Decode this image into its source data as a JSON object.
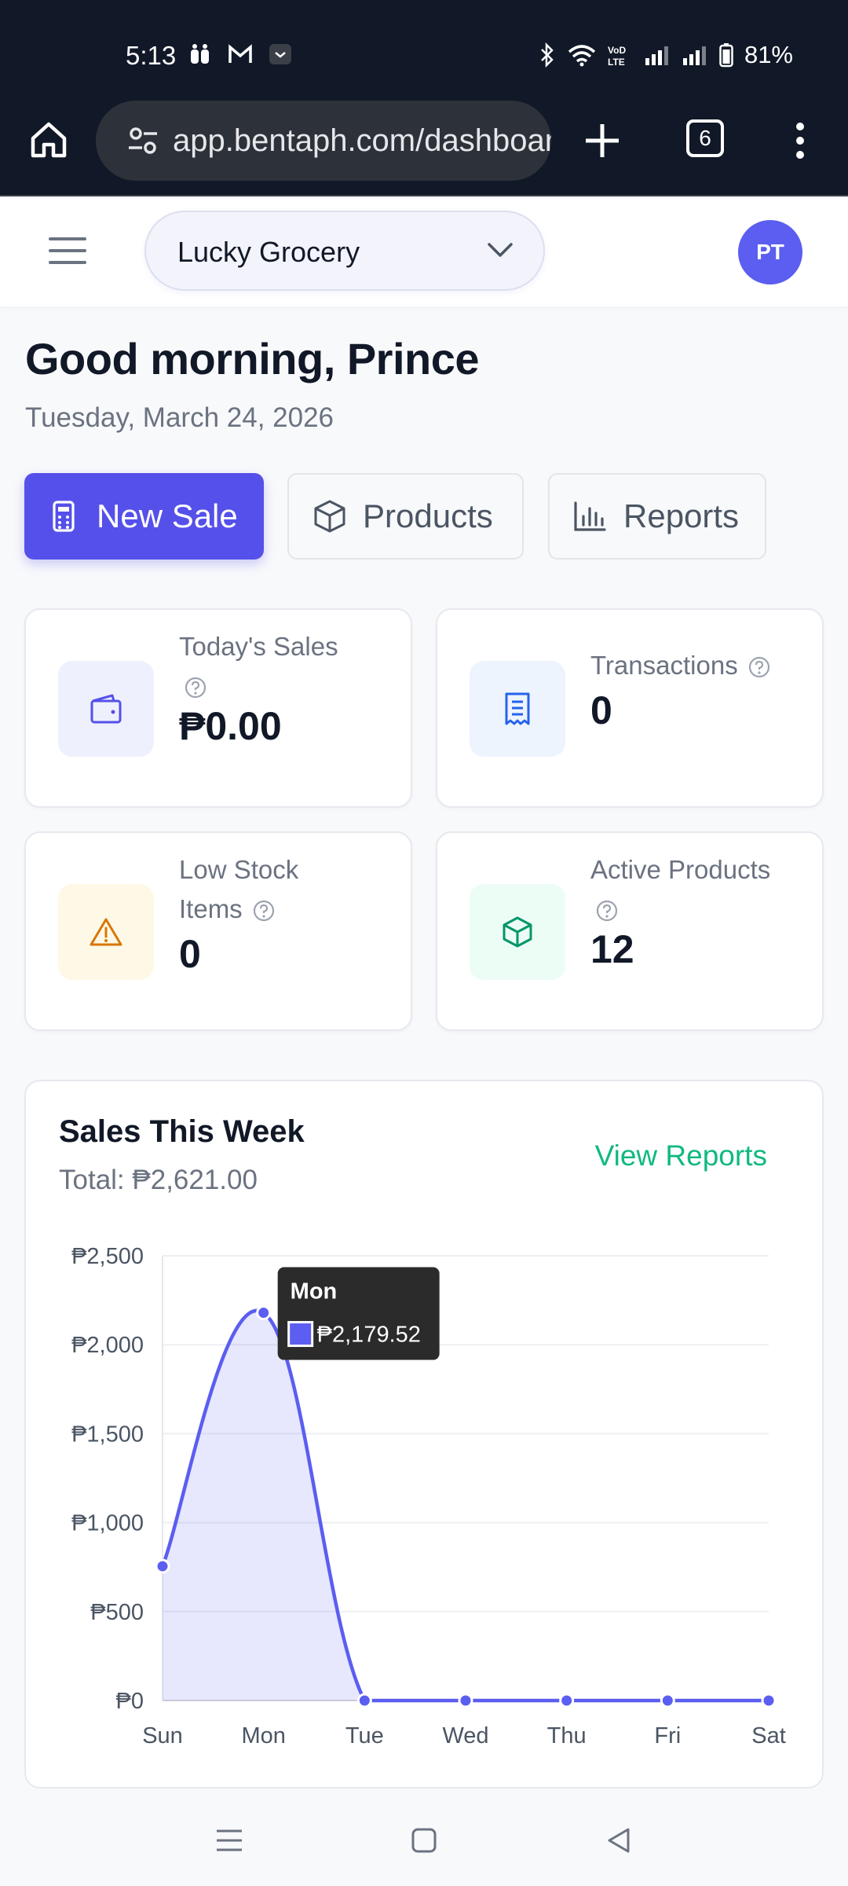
{
  "status": {
    "time": "5:13",
    "battery": "81%"
  },
  "browser": {
    "url": "app.bentaph.com/dashboard",
    "tab_count": "6"
  },
  "header": {
    "store_name": "Lucky Grocery",
    "avatar_initials": "PT"
  },
  "greeting": {
    "title": "Good morning, Prince",
    "date": "Tuesday, March 24, 2026"
  },
  "actions": {
    "new_sale": "New Sale",
    "products": "Products",
    "reports": "Reports"
  },
  "stats": {
    "todays_sales": {
      "label": "Today's Sales",
      "value": "₱0.00"
    },
    "transactions": {
      "label": "Transactions",
      "value": "0"
    },
    "low_stock": {
      "label": "Low Stock Items",
      "value": "0"
    },
    "active_products": {
      "label": "Active Products",
      "value": "12"
    }
  },
  "sales_chart": {
    "title": "Sales This Week",
    "total": "Total: ₱2,621.00",
    "view_link": "View Reports",
    "tooltip_day": "Mon",
    "tooltip_value": "₱2,179.52"
  },
  "colors": {
    "accent": "#5550ea",
    "link": "#10b981",
    "line": "#5b5ef0"
  },
  "chart_data": {
    "type": "area",
    "categories": [
      "Sun",
      "Mon",
      "Tue",
      "Wed",
      "Thu",
      "Fri",
      "Sat"
    ],
    "values": [
      755,
      2179.52,
      0,
      0,
      0,
      0,
      0
    ],
    "y_ticks": [
      "₱0",
      "₱500",
      "₱1,000",
      "₱1,500",
      "₱2,000",
      "₱2,500"
    ],
    "ylim": [
      0,
      2500
    ],
    "grid": true
  }
}
